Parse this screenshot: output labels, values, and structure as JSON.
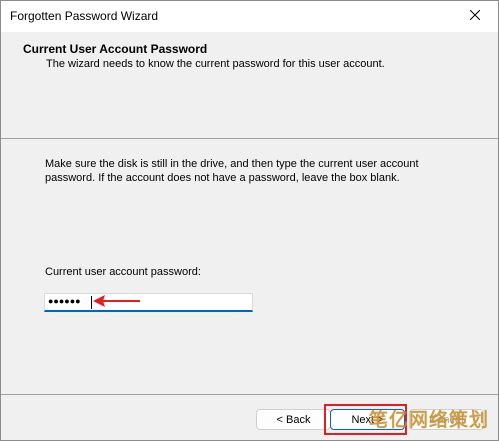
{
  "window": {
    "title": "Forgotten Password Wizard"
  },
  "header": {
    "title": "Current User Account Password",
    "subtitle": "The wizard needs to know the current password for this user account."
  },
  "body": {
    "instructions": "Make sure the disk is still in the drive, and then type the current user account password. If the account does not have a password, leave the box blank.",
    "field_label": "Current user account password:",
    "password_masked": "●●●●●●"
  },
  "buttons": {
    "back": "< Back",
    "next": "Next >",
    "cancel": "Cancel"
  },
  "watermark": "笔亿网络策划",
  "colors": {
    "accent": "#0067c0",
    "annotation_red": "#e02020"
  }
}
